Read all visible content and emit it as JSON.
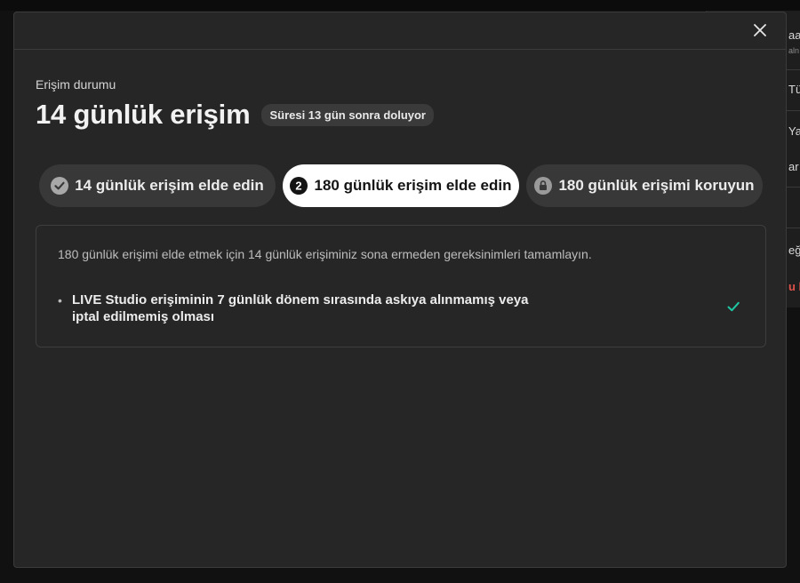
{
  "background": {
    "items": [
      "aa",
      "aln",
      "Tü",
      "Yay",
      "ar",
      "eğ",
      "u k"
    ]
  },
  "modal": {
    "eyebrow": "Erişim durumu",
    "title": "14 günlük erişim",
    "expiry_badge": "Süresi 13 gün sonra doluyor",
    "steps": [
      {
        "label": "14 günlük erişim elde edin",
        "icon": "check-circle-icon",
        "state": "completed"
      },
      {
        "label": "180 günlük erişim elde edin",
        "icon": "number-2-circle-icon",
        "state": "active"
      },
      {
        "label": "180 günlük erişimi koruyun",
        "icon": "lock-circle-icon",
        "state": "locked"
      }
    ],
    "requirements": {
      "intro": "180 günlük erişimi elde etmek için 14 günlük erişiminiz sona ermeden gereksinimleri tamamlayın.",
      "items": [
        {
          "bullet": "•",
          "text": "LIVE Studio erişiminin 7 günlük dönem sırasında askıya alınmamış veya iptal edilmemiş olması",
          "status": "met"
        }
      ]
    }
  },
  "colors": {
    "modal_bg": "#262626",
    "active_step_bg": "#ffffff",
    "step_bg": "#383838",
    "check_accent": "#1fc7a3"
  }
}
